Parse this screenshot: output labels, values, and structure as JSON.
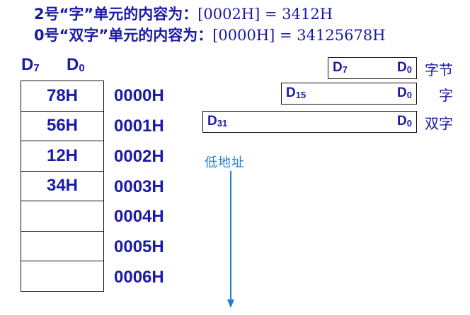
{
  "header": {
    "line1_prefix": "2号“字”单元的内容为：",
    "line1_expr": "[0002H] = 3412H",
    "line2_prefix": "0号“双字”单元的内容为：",
    "line2_expr": "[0000H] = 34125678H"
  },
  "memory_column": {
    "bit_high": "D",
    "bit_high_sub": "7",
    "bit_low": "D",
    "bit_low_sub": "0",
    "cells": [
      "78H",
      "56H",
      "12H",
      "34H",
      "",
      "",
      ""
    ],
    "addresses": [
      "0000H",
      "0001H",
      "0002H",
      "0003H",
      "0004H",
      "0005H",
      "0006H"
    ]
  },
  "widths": {
    "byte": {
      "hi": "D",
      "hi_sub": "7",
      "lo": "D",
      "lo_sub": "0",
      "label": "字节"
    },
    "word": {
      "hi": "D",
      "hi_sub": "15",
      "lo": "D",
      "lo_sub": "0",
      "label": "字"
    },
    "dword": {
      "hi": "D",
      "hi_sub": "31",
      "lo": "D",
      "lo_sub": "0",
      "label": "双字"
    }
  },
  "low_address_label": "低地址",
  "colors": {
    "text_blue": "#1a1aa6",
    "arrow_blue": "#1f7fd6",
    "border": "#111111"
  }
}
